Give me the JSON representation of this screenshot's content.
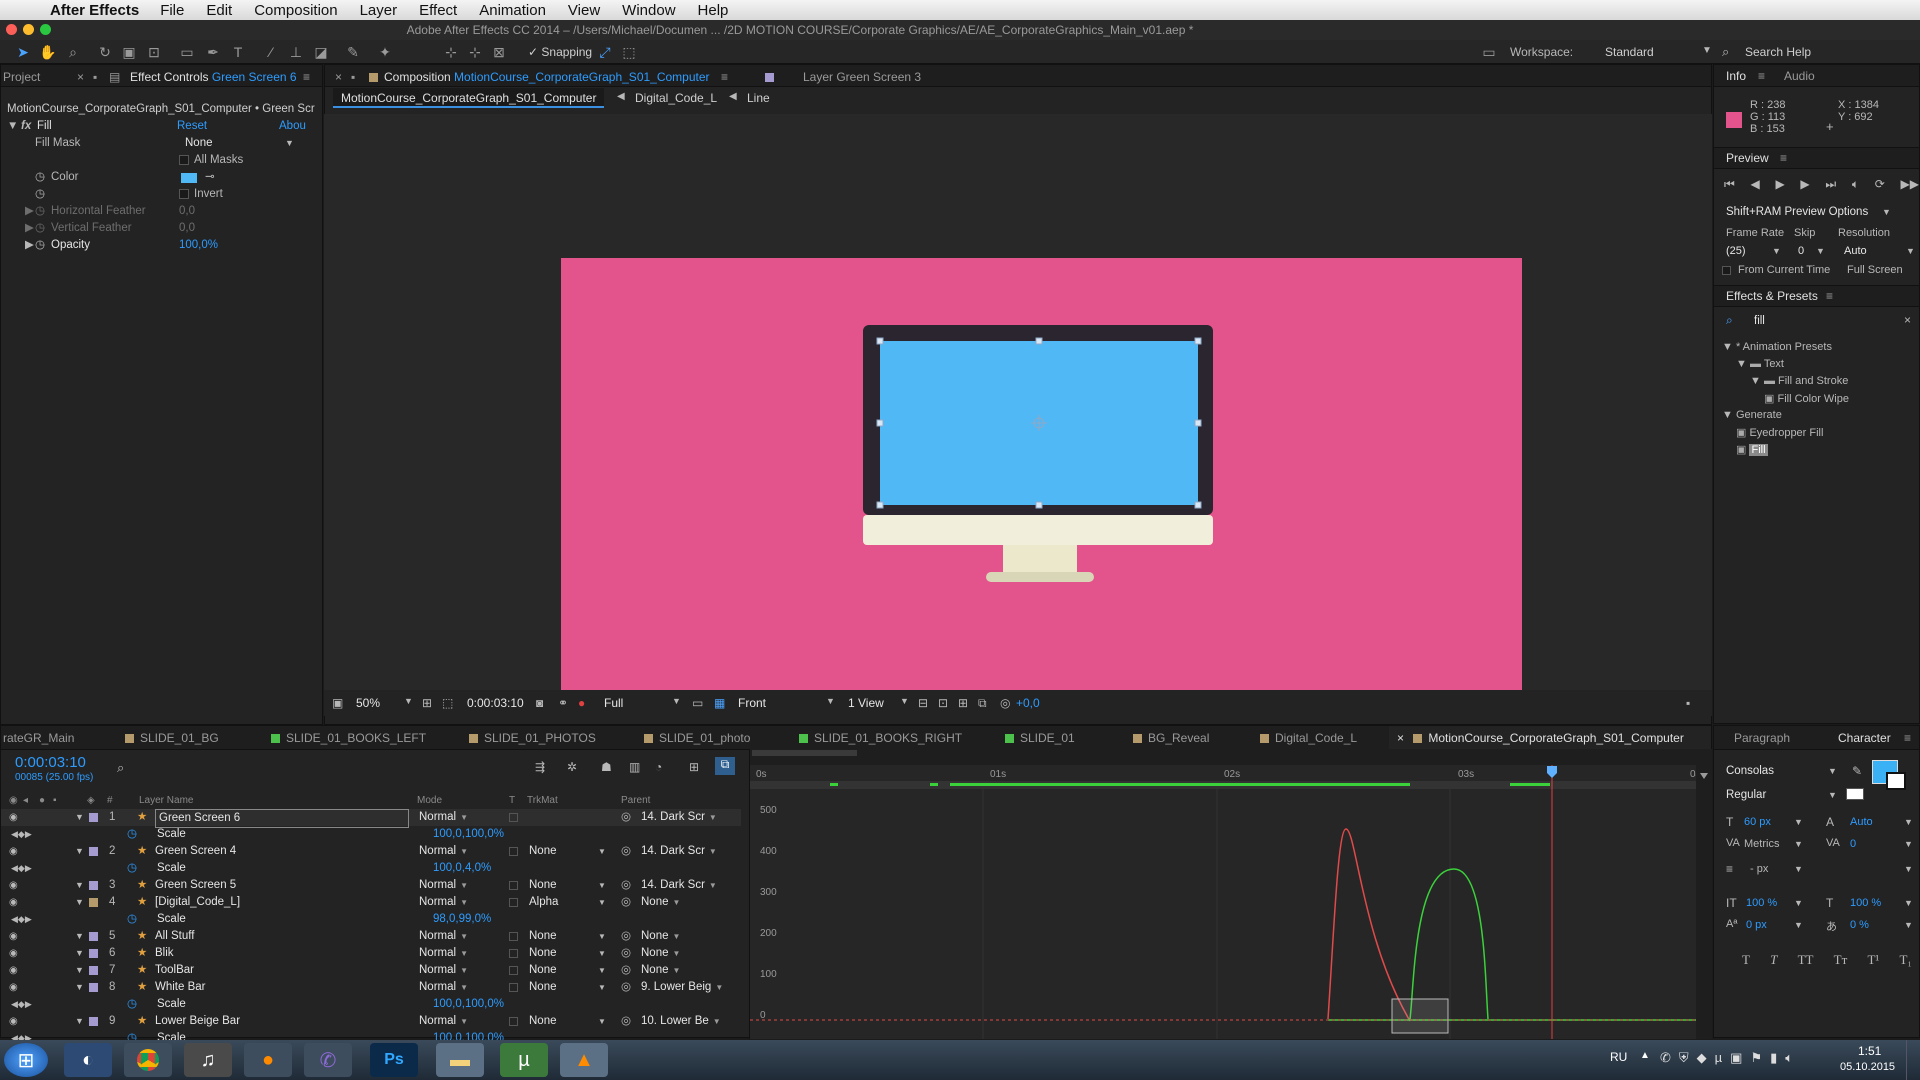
{
  "menubar": {
    "app": "After Effects",
    "items": [
      "File",
      "Edit",
      "Composition",
      "Layer",
      "Effect",
      "Animation",
      "View",
      "Window",
      "Help"
    ]
  },
  "titlebar": {
    "title": "Adobe After Effects CC 2014 – /Users/Michael/Documen ... /2D MOTION COURSE/Corporate Graphics/AE/AE_CorporateGraphics_Main_v01.aep *"
  },
  "toolbar": {
    "snapping": "Snapping",
    "workspace_label": "Workspace:",
    "workspace_value": "Standard",
    "search_help": "Search Help"
  },
  "left_panel": {
    "tab_project": "Project",
    "tab_effect_controls": "Effect Controls",
    "tab_layer": "Green Screen 6",
    "breadcrumb": "MotionCourse_CorporateGraph_S01_Computer • Green Scr",
    "effect_name": "Fill",
    "reset": "Reset",
    "about": "Abou",
    "rows": [
      {
        "label": "Fill Mask",
        "value": "None"
      },
      {
        "label": "",
        "value": "All Masks"
      },
      {
        "label": "Color",
        "value": ""
      },
      {
        "label": "",
        "value": "Invert"
      },
      {
        "label": "Horizontal Feather",
        "value": "0,0"
      },
      {
        "label": "Vertical Feather",
        "value": "0,0"
      },
      {
        "label": "Opacity",
        "value": "100,0%"
      }
    ]
  },
  "comp_panel": {
    "tab_label": "Composition",
    "comp_name": "MotionCourse_CorporateGraph_S01_Computer",
    "layer_tab": "Layer Green Screen 3",
    "crumbs": [
      "MotionCourse_CorporateGraph_S01_Computer",
      "Digital_Code_L",
      "Line"
    ],
    "zoom": "50%",
    "timecode": "0:00:03:10",
    "resolution": "Full",
    "view": "Front",
    "views": "1 View",
    "exposure": "+0,0",
    "canvas_color": "#e4548c",
    "screen_color": "#4fb8f5"
  },
  "timeline": {
    "tabs": [
      "rateGR_Main",
      "SLIDE_01_BG",
      "SLIDE_01_BOOKS_LEFT",
      "SLIDE_01_PHOTOS",
      "SLIDE_01_photo",
      "SLIDE_01_BOOKS_RIGHT",
      "SLIDE_01",
      "BG_Reveal",
      "Digital_Code_L",
      "MotionCourse_CorporateGraph_S01_Computer"
    ],
    "timecode": "0:00:03:10",
    "frame_info": "00085 (25.00 fps)",
    "col_headers": {
      "num": "#",
      "name": "Layer Name",
      "mode": "Mode",
      "t": "T",
      "trkmat": "TrkMat",
      "parent": "Parent"
    },
    "ruler": [
      "0s",
      "01s",
      "02s",
      "03s",
      "04"
    ],
    "graph_labels": [
      "500",
      "400",
      "300",
      "200",
      "100",
      "0"
    ],
    "rows": [
      {
        "num": "1",
        "name": "Green Screen 6",
        "mode": "Normal",
        "trk": "",
        "parent": "14. Dark Scr",
        "sel": true
      },
      {
        "sub": "Scale",
        "value": "100,0,100,0%"
      },
      {
        "num": "2",
        "name": "Green Screen 4",
        "mode": "Normal",
        "trk": "None",
        "parent": "14. Dark Scr"
      },
      {
        "sub": "Scale",
        "value": "100,0,4,0%"
      },
      {
        "num": "3",
        "name": "Green Screen 5",
        "mode": "Normal",
        "trk": "None",
        "parent": "14. Dark Scr"
      },
      {
        "num": "4",
        "name": "[Digital_Code_L]",
        "mode": "Normal",
        "trk": "Alpha",
        "parent": "None"
      },
      {
        "sub": "Scale",
        "value": "98,0,99,0%"
      },
      {
        "num": "5",
        "name": "All Stuff",
        "mode": "Normal",
        "trk": "None",
        "parent": "None"
      },
      {
        "num": "6",
        "name": "Blik",
        "mode": "Normal",
        "trk": "None",
        "parent": "None"
      },
      {
        "num": "7",
        "name": "ToolBar",
        "mode": "Normal",
        "trk": "None",
        "parent": "None"
      },
      {
        "num": "8",
        "name": "White Bar",
        "mode": "Normal",
        "trk": "None",
        "parent": "9. Lower Beig"
      },
      {
        "sub": "Scale",
        "value": "100,0,100,0%"
      },
      {
        "num": "9",
        "name": "Lower Beige Bar",
        "mode": "Normal",
        "trk": "None",
        "parent": "10. Lower Be"
      },
      {
        "sub": "Scale",
        "value": "100,0,100,0%"
      }
    ]
  },
  "info_panel": {
    "tab": "Info",
    "tab2": "Audio",
    "r": "R : 238",
    "g": "G : 113",
    "b": "B : 153",
    "x": "X : 1384",
    "y": "Y : 692",
    "swatch": "#e4548c"
  },
  "preview_panel": {
    "tab": "Preview",
    "options": "Shift+RAM Preview Options",
    "frame_rate_label": "Frame Rate",
    "skip_label": "Skip",
    "res_label": "Resolution",
    "frame_rate": "(25)",
    "skip": "0",
    "res": "Auto",
    "from_current": "From Current Time",
    "full_screen": "Full Screen"
  },
  "effects_panel": {
    "tab": "Effects & Presets",
    "search": "fill",
    "tree": [
      {
        "label": "* Animation Presets",
        "indent": 0
      },
      {
        "label": "Text",
        "indent": 1
      },
      {
        "label": "Fill and Stroke",
        "indent": 2
      },
      {
        "label": "Fill Color Wipe",
        "indent": 3
      },
      {
        "label": "Generate",
        "indent": 0
      },
      {
        "label": "Eyedropper Fill",
        "indent": 1
      },
      {
        "label": "Fill",
        "indent": 1,
        "sel": true
      }
    ]
  },
  "character_panel": {
    "tab1": "Paragraph",
    "tab2": "Character",
    "font": "Consolas",
    "style": "Regular",
    "size": "60 px",
    "leading": "Auto",
    "kerning": "Metrics",
    "tracking": "0",
    "stroke": "- px",
    "vscale": "100 %",
    "hscale": "100 %",
    "baseline": "0 px",
    "tsume": "0 %",
    "fill_color": "#3ab0f5"
  },
  "taskbar": {
    "lang": "RU",
    "time": "1:51",
    "date": "05.10.2015"
  }
}
